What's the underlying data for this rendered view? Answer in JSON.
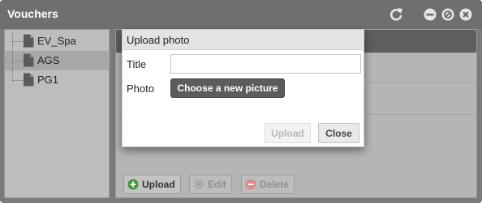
{
  "window": {
    "title": "Vouchers"
  },
  "tree": {
    "items": [
      {
        "label": "EV_Spa",
        "selected": false
      },
      {
        "label": "AGS",
        "selected": true
      },
      {
        "label": "PG1",
        "selected": false
      }
    ]
  },
  "toolbar": {
    "upload_label": "Upload",
    "edit_label": "Edit",
    "delete_label": "Delete"
  },
  "modal": {
    "title": "Upload photo",
    "title_field_label": "Title",
    "title_field_value": "",
    "photo_field_label": "Photo",
    "choose_button_label": "Choose a new picture",
    "upload_button_label": "Upload",
    "close_button_label": "Close"
  },
  "colors": {
    "titlebar": "#6f6f6f",
    "overlay": "#7a7a7a",
    "choose_button": "#5c5c5c",
    "upload_icon_green": "#3c9a3c",
    "delete_icon_red": "#d64b4b"
  }
}
